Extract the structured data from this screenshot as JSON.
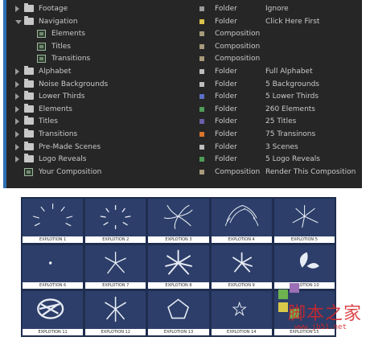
{
  "project_panel": {
    "rows": [
      {
        "kind": "folder",
        "indent": 0,
        "expanded": false,
        "name": "Footage",
        "label_color": "#9a9a9a",
        "type": "Folder",
        "comment": "Ignore"
      },
      {
        "kind": "folder",
        "indent": 0,
        "expanded": true,
        "name": "Navigation",
        "label_color": "#d9c24a",
        "type": "Folder",
        "comment": "Click Here First"
      },
      {
        "kind": "comp",
        "indent": 1,
        "name": "Elements",
        "label_color": "#a89a7a",
        "type": "Composition",
        "comment": ""
      },
      {
        "kind": "comp",
        "indent": 1,
        "name": "Titles",
        "label_color": "#a89a7a",
        "type": "Composition",
        "comment": ""
      },
      {
        "kind": "comp",
        "indent": 1,
        "name": "Transitions",
        "label_color": "#a89a7a",
        "type": "Composition",
        "comment": ""
      },
      {
        "kind": "folder",
        "indent": 0,
        "expanded": false,
        "name": "Alphabet",
        "label_color": "#bdbdbd",
        "type": "Folder",
        "comment": "Full Alphabet"
      },
      {
        "kind": "folder",
        "indent": 0,
        "expanded": false,
        "name": "Noise Backgrounds",
        "label_color": "#bdbdbd",
        "type": "Folder",
        "comment": "5 Backgrounds"
      },
      {
        "kind": "folder",
        "indent": 0,
        "expanded": false,
        "name": "Lower Thirds",
        "label_color": "#5a6fc4",
        "type": "Folder",
        "comment": "5 Lower Thirds"
      },
      {
        "kind": "folder",
        "indent": 0,
        "expanded": false,
        "name": "Elements",
        "label_color": "#4f9b57",
        "type": "Folder",
        "comment": "260 Elements"
      },
      {
        "kind": "folder",
        "indent": 0,
        "expanded": false,
        "name": "Titles",
        "label_color": "#6a5fa8",
        "type": "Folder",
        "comment": "25 Titles"
      },
      {
        "kind": "folder",
        "indent": 0,
        "expanded": false,
        "name": "Transitions",
        "label_color": "#d9742a",
        "type": "Folder",
        "comment": "75 Transinons"
      },
      {
        "kind": "folder",
        "indent": 0,
        "expanded": false,
        "name": "Pre-Made Scenes",
        "label_color": "#bdbdbd",
        "type": "Folder",
        "comment": "3 Scenes"
      },
      {
        "kind": "folder",
        "indent": 0,
        "expanded": false,
        "name": "Logo Reveals",
        "label_color": "#4f9b57",
        "type": "Folder",
        "comment": "5 Logo Reveals"
      },
      {
        "kind": "comp",
        "indent": 0,
        "name": "Your Composition",
        "label_color": "#a89a7a",
        "type": "Composition",
        "comment": "Render This Composition"
      }
    ]
  },
  "thumbnails": [
    {
      "caption": "EXPLOTION 1",
      "shape": "burst"
    },
    {
      "caption": "EXPLOTION 2",
      "shape": "ring-dashes"
    },
    {
      "caption": "EXPLOTION 3",
      "shape": "swirl"
    },
    {
      "caption": "EXPLOTION 4",
      "shape": "arc-burst"
    },
    {
      "caption": "EXPLOTION 5",
      "shape": "sparse-burst"
    },
    {
      "caption": "EXPLOTION 6",
      "shape": "dot"
    },
    {
      "caption": "EXPLOTION 7",
      "shape": "star-lines"
    },
    {
      "caption": "EXPLOTION 8",
      "shape": "asterisk"
    },
    {
      "caption": "EXPLOTION 9",
      "shape": "asterisk-small"
    },
    {
      "caption": "EXPLOTION 10",
      "shape": "leaf"
    },
    {
      "caption": "EXPLOTION 11",
      "shape": "scribble"
    },
    {
      "caption": "EXPLOTION 12",
      "shape": "six-lines"
    },
    {
      "caption": "EXPLOTION 13",
      "shape": "pentagon"
    },
    {
      "caption": "EXPLOTION 14",
      "shape": "small-star"
    },
    {
      "caption": "EXPLOTION 15",
      "shape": "blank"
    }
  ],
  "watermark": {
    "title": "脚本之家",
    "url": "www.jb51.net",
    "colors": [
      "#6db24f",
      "#9a6fb5",
      "#d8c94a",
      "#6db24f"
    ]
  }
}
